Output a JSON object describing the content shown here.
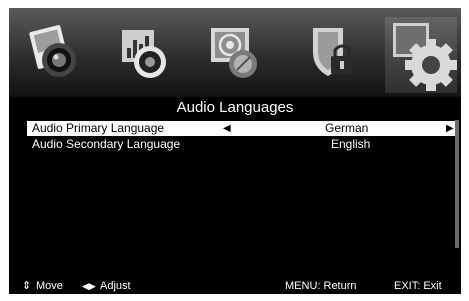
{
  "menu": {
    "title": "Audio Languages",
    "items": [
      {
        "label": "Audio Primary Language",
        "value": "German",
        "selected": true
      },
      {
        "label": "Audio Secondary Language",
        "value": "English",
        "selected": false
      }
    ]
  },
  "tabs": [
    {
      "icon": "picture-icon"
    },
    {
      "icon": "sound-icon"
    },
    {
      "icon": "channel-icon"
    },
    {
      "icon": "lock-icon"
    },
    {
      "icon": "setup-icon",
      "selected": true
    }
  ],
  "footer": {
    "move": "Move",
    "adjust": "Adjust",
    "return": "MENU: Return",
    "exit": "EXIT: Exit"
  },
  "colors": {
    "background": "#000000",
    "highlight": "#ffffff",
    "text": "#ffffff"
  }
}
